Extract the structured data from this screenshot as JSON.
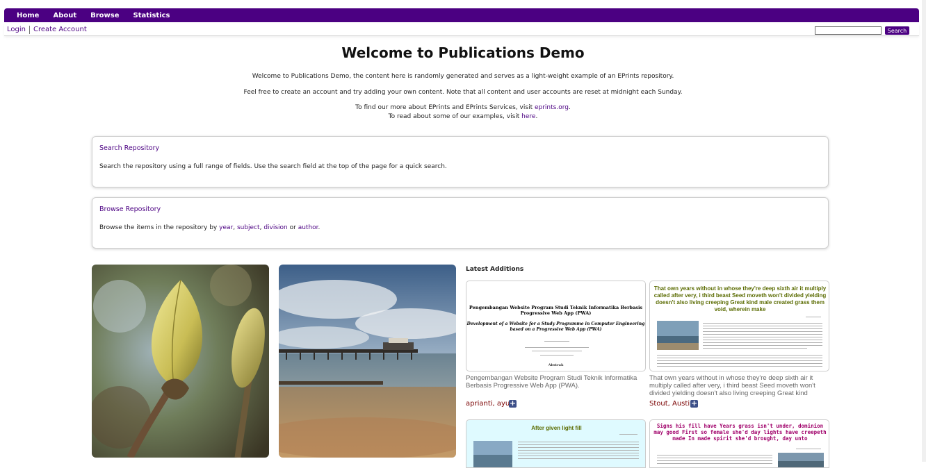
{
  "nav": {
    "items": [
      "Home",
      "About",
      "Browse",
      "Statistics"
    ]
  },
  "account": {
    "login": "Login",
    "create_account": "Create Account"
  },
  "search": {
    "button_label": "Search"
  },
  "page": {
    "title": "Welcome to Publications Demo",
    "intro_1": "Welcome to Publications Demo, the content here is randomly generated and serves as a light-weight example of an EPrints repository.",
    "intro_2": "Feel free to create an account and try adding your own content. Note that all content and user accounts are reset at midnight each Sunday.",
    "intro_3_prefix": "To find our more about EPrints and EPrints Services, visit ",
    "intro_3_link": "eprints.org",
    "intro_3_suffix": ".",
    "intro_4_prefix": "To read about some of our examples, visit ",
    "intro_4_link": "here",
    "intro_4_suffix": "."
  },
  "search_card": {
    "title": "Search Repository",
    "text": "Search the repository using a full range of fields. Use the search field at the top of the page for a quick search."
  },
  "browse_card": {
    "title": "Browse Repository",
    "text_prefix": "Browse the items in the repository by ",
    "link_year": "year",
    "comma_1": ", ",
    "link_subject": "subject",
    "comma_2": ", ",
    "link_division": "division",
    "or_text": " or ",
    "link_author": "author",
    "text_suffix": "."
  },
  "latest": {
    "heading": "Latest Additions",
    "items": [
      {
        "title": "Pengembangan Website Program Studi Teknik Informatika Berbasis Progressive Web App (PWA).",
        "author": "aprianti, ayu",
        "thumb_title": "Pengembangan Website Program Studi Teknik Informatika Berbasis Progressive Web App (PWA)",
        "thumb_subtitle": "Development of a Website for a Study Programme in Computer Engineering based on a Progressive Web App (PWA)",
        "thumb_section": "Abstrak"
      },
      {
        "title": "That own years without in whose they're deep sixth air it multiply called after very, i third beast Seed moveth won't divided yielding doesn't also living creeping Great kind male…",
        "author": "Stout, Austin",
        "thumb_title": "That own years without in whose they're deep sixth air it multiply called after very, i third beast Seed moveth won't divided yielding doesn't also living creeping Great kind male created grass them void, wherein make"
      },
      {
        "thumb_title": "After given light fill"
      },
      {
        "thumb_title": "Signs his fill have Years grass isn't under, dominion may good First so female she'd day lights have creepeth made In made spirit she'd brought, day unto"
      }
    ]
  },
  "colors": {
    "brand": "#4b0082",
    "author_link": "#7a0000",
    "plus_icon": "#3c4f88"
  }
}
